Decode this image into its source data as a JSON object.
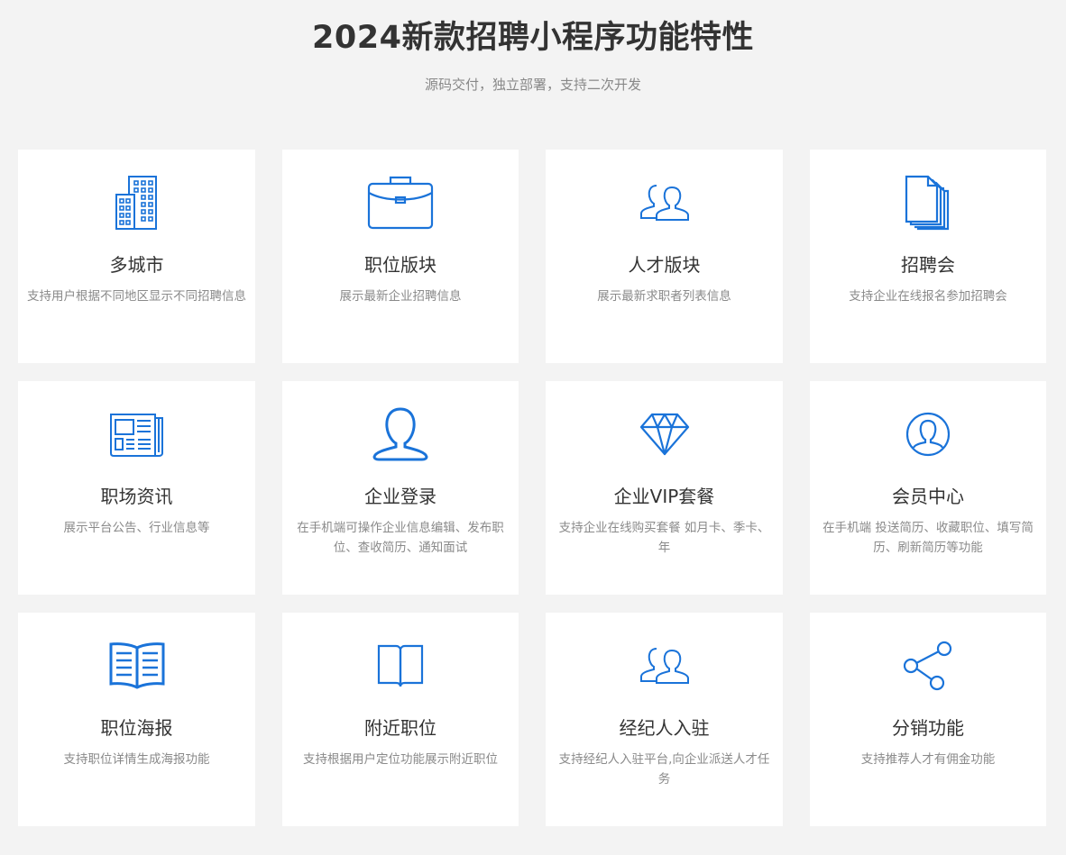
{
  "header": {
    "title": "2024新款招聘小程序功能特性",
    "subtitle": "源码交付，独立部署，支持二次开发"
  },
  "colors": {
    "accent": "#1a73d9",
    "background": "#f3f3f3",
    "card": "#ffffff"
  },
  "features": [
    {
      "icon": "buildings-icon",
      "title": "多城市",
      "desc": "支持用户根据不同地区显示不同招聘信息"
    },
    {
      "icon": "briefcase-icon",
      "title": "职位版块",
      "desc": "展示最新企业招聘信息"
    },
    {
      "icon": "users-icon",
      "title": "人才版块",
      "desc": "展示最新求职者列表信息"
    },
    {
      "icon": "documents-icon",
      "title": "招聘会",
      "desc": "支持企业在线报名参加招聘会"
    },
    {
      "icon": "newspaper-icon",
      "title": "职场资讯",
      "desc": "展示平台公告、行业信息等"
    },
    {
      "icon": "user-icon",
      "title": "企业登录",
      "desc": "在手机端可操作企业信息编辑、发布职位、查收简历、通知面试"
    },
    {
      "icon": "diamond-icon",
      "title": "企业VIP套餐",
      "desc": "支持企业在线购买套餐 如月卡、季卡、年"
    },
    {
      "icon": "user-circle-icon",
      "title": "会员中心",
      "desc": "在手机端 投送简历、收藏职位、填写简历、刷新简历等功能"
    },
    {
      "icon": "open-book-icon",
      "title": "职位海报",
      "desc": "支持职位详情生成海报功能"
    },
    {
      "icon": "book-outline-icon",
      "title": "附近职位",
      "desc": "支持根据用户定位功能展示附近职位"
    },
    {
      "icon": "users-icon",
      "title": "经纪人入驻",
      "desc": "支持经纪人入驻平台,向企业派送人才任务"
    },
    {
      "icon": "share-icon",
      "title": "分销功能",
      "desc": "支持推荐人才有佣金功能"
    }
  ]
}
